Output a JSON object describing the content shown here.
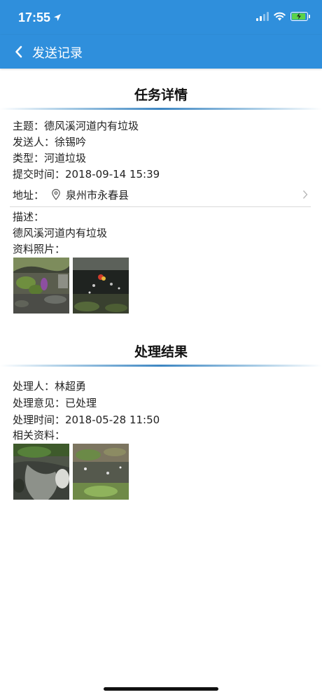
{
  "status": {
    "time": "17:55"
  },
  "header": {
    "title": "发送记录"
  },
  "task": {
    "section_title": "任务详情",
    "subject_label": "主题：",
    "subject": "德风溪河道内有垃圾",
    "sender_label": "发送人：",
    "sender": "徐锡吟",
    "type_label": "类型：",
    "type": "河道垃圾",
    "time_label": "提交时间：",
    "time": "2018-09-14 15:39",
    "address_label": "地址：",
    "address": "泉州市永春县",
    "desc_label": "描述：",
    "desc": "德风溪河道内有垃圾",
    "photos_label": "资料照片："
  },
  "result": {
    "section_title": "处理结果",
    "handler_label": "处理人：",
    "handler": "林超勇",
    "opinion_label": "处理意见：",
    "opinion": "已处理",
    "time_label": "处理时间：",
    "time": "2018-05-28 11:50",
    "files_label": "相关资料："
  },
  "colors": {
    "accent": "#2f8fdc",
    "battery": "#5bd34a"
  }
}
